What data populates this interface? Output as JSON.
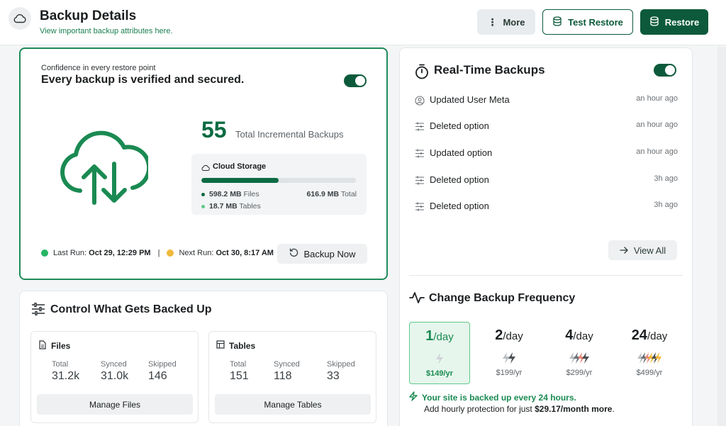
{
  "header": {
    "title": "Backup Details",
    "subtitle": "View important backup attributes here.",
    "more_label": "More",
    "test_restore_label": "Test Restore",
    "restore_label": "Restore"
  },
  "verify": {
    "eyebrow": "Confidence in every restore point",
    "heading": "Every backup is verified and secured.",
    "toggle_on": true,
    "count": "55",
    "count_label": "Total Incremental Backups",
    "storage": {
      "title": "Cloud Storage",
      "used_fraction": 0.5,
      "files_value": "598.2 MB",
      "files_label": "Files",
      "tables_value": "18.7 MB",
      "tables_label": "Tables",
      "total_value": "616.9 MB",
      "total_label": "Total"
    },
    "last_run_label": "Last Run:",
    "last_run_value": "Oct 29, 12:29 PM",
    "separator": "|",
    "next_run_label": "Next Run:",
    "next_run_value": "Oct 30, 8:17 AM",
    "backup_now_label": "Backup Now"
  },
  "realtime": {
    "title": "Real-Time Backups",
    "toggle_on": true,
    "items": [
      {
        "icon": "user-circle-icon",
        "label": "Updated User Meta",
        "time": "an hour ago"
      },
      {
        "icon": "sliders-icon",
        "label": "Deleted option",
        "time": "an hour ago"
      },
      {
        "icon": "sliders-icon",
        "label": "Updated option",
        "time": "an hour ago"
      },
      {
        "icon": "sliders-icon",
        "label": "Deleted option",
        "time": "3h ago"
      },
      {
        "icon": "sliders-icon",
        "label": "Deleted option",
        "time": "3h ago"
      }
    ],
    "view_all_label": "View All"
  },
  "frequency": {
    "title": "Change Backup Frequency",
    "plans": [
      {
        "num": "1",
        "unit": "/day",
        "price": "$149/yr",
        "selected": true
      },
      {
        "num": "2",
        "unit": "/day",
        "price": "$199/yr",
        "selected": false
      },
      {
        "num": "4",
        "unit": "/day",
        "price": "$299/yr",
        "selected": false
      },
      {
        "num": "24",
        "unit": "/day",
        "price": "$499/yr",
        "selected": false
      }
    ],
    "notice_green": "Your site is backed up every 24 hours.",
    "notice_prefix": "Add hourly protection for just",
    "notice_price": "$29.17/month more",
    "notice_suffix": "."
  },
  "control": {
    "title": "Control What Gets Backed Up",
    "files": {
      "title": "Files",
      "total_label": "Total",
      "total_value": "31.2k",
      "synced_label": "Synced",
      "synced_value": "31.0k",
      "skipped_label": "Skipped",
      "skipped_value": "146",
      "button_label": "Manage Files"
    },
    "tables": {
      "title": "Tables",
      "total_label": "Total",
      "total_value": "151",
      "synced_label": "Synced",
      "synced_value": "118",
      "skipped_label": "Skipped",
      "skipped_value": "33",
      "button_label": "Manage Tables"
    }
  },
  "colors": {
    "brand_dark": "#0c5a3b",
    "brand_green": "#1a8a52",
    "last_run_dot": "#27b565",
    "next_run_dot": "#f0b93a",
    "tables_dot": "#5ec98a"
  }
}
